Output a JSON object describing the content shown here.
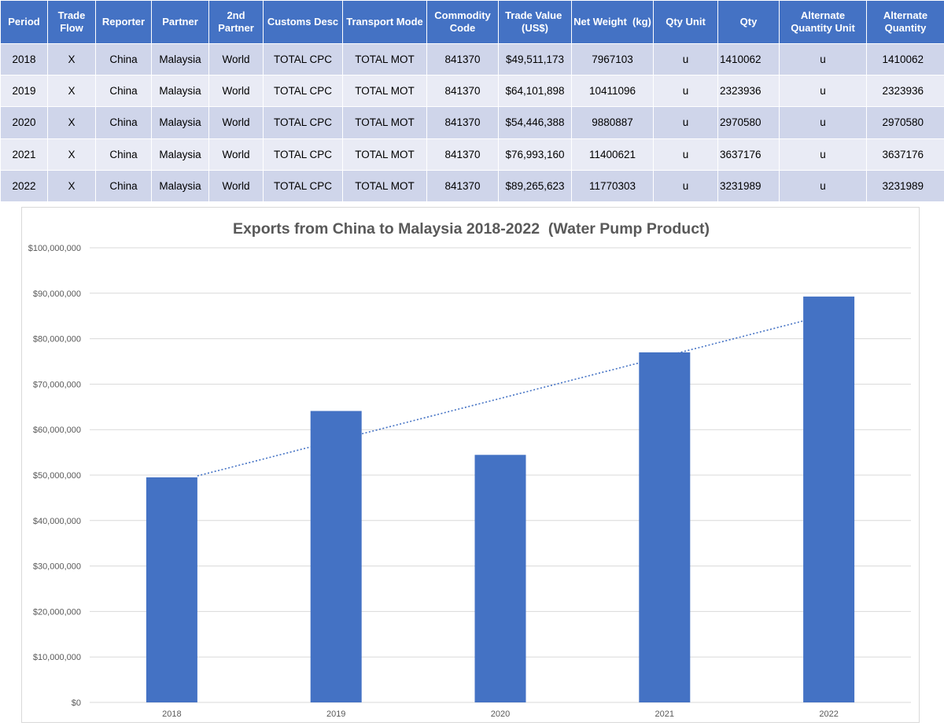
{
  "table": {
    "headers": [
      "Period",
      "Trade Flow",
      "Reporter",
      "Partner",
      "2nd Partner",
      "Customs Desc",
      "Transport Mode",
      "Commodity Code",
      "Trade Value  (US$)",
      "Net Weight  (kg)",
      "Qty Unit",
      "Qty",
      "Alternate Quantity Unit",
      "Alternate Quantity"
    ],
    "rows": [
      [
        "2018",
        "X",
        "China",
        "Malaysia",
        "World",
        "TOTAL CPC",
        "TOTAL MOT",
        "841370",
        "$49,511,173",
        "7967103",
        "u",
        "1410062",
        "u",
        "1410062"
      ],
      [
        "2019",
        "X",
        "China",
        "Malaysia",
        "World",
        "TOTAL CPC",
        "TOTAL MOT",
        "841370",
        "$64,101,898",
        "10411096",
        "u",
        "2323936",
        "u",
        "2323936"
      ],
      [
        "2020",
        "X",
        "China",
        "Malaysia",
        "World",
        "TOTAL CPC",
        "TOTAL MOT",
        "841370",
        "$54,446,388",
        "9880887",
        "u",
        "2970580",
        "u",
        "2970580"
      ],
      [
        "2021",
        "X",
        "China",
        "Malaysia",
        "World",
        "TOTAL CPC",
        "TOTAL MOT",
        "841370",
        "$76,993,160",
        "11400621",
        "u",
        "3637176",
        "u",
        "3637176"
      ],
      [
        "2022",
        "X",
        "China",
        "Malaysia",
        "World",
        "TOTAL CPC",
        "TOTAL MOT",
        "841370",
        "$89,265,623",
        "11770303",
        "u",
        "3231989",
        "u",
        "3231989"
      ]
    ]
  },
  "colors": {
    "header_bg": "#4472c4",
    "row_odd_bg": "#cfd5ea",
    "row_even_bg": "#e9ebf5",
    "bar": "#4472c4",
    "trendline": "#4472c4"
  },
  "chart_data": {
    "type": "bar",
    "title": "Exports from China to Malaysia 2018-2022  (Water Pump Product)",
    "categories": [
      "2018",
      "2019",
      "2020",
      "2021",
      "2022"
    ],
    "values": [
      49511173,
      64101898,
      54446388,
      76993160,
      89265623
    ],
    "xlabel": "",
    "ylabel": "",
    "ylim": [
      0,
      100000000
    ],
    "y_ticks": [
      "$0",
      "$10,000,000",
      "$20,000,000",
      "$30,000,000",
      "$40,000,000",
      "$50,000,000",
      "$60,000,000",
      "$70,000,000",
      "$80,000,000",
      "$90,000,000",
      "$100,000,000"
    ],
    "grid": true,
    "legend": "none",
    "trendline": "linear, dotted"
  }
}
